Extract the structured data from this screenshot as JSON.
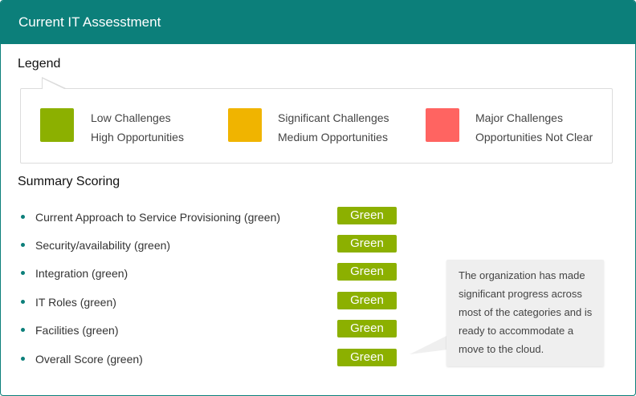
{
  "header": {
    "title": "Current IT Assesstment"
  },
  "legend": {
    "title": "Legend",
    "items": [
      {
        "line1": "Low Challenges",
        "line2": "High Opportunities",
        "color": "#8cb000",
        "icon": "swatch-green"
      },
      {
        "line1": "Significant Challenges",
        "line2": "Medium Opportunities",
        "color": "#f0b400",
        "icon": "swatch-yellow"
      },
      {
        "line1": "Major Challenges",
        "line2": "Opportunities Not Clear",
        "color": "#ff6461",
        "icon": "swatch-red"
      }
    ]
  },
  "summary": {
    "title": "Summary Scoring",
    "items": [
      {
        "label": "Current Approach to Service Provisioning (green)",
        "score": "Green"
      },
      {
        "label": "Security/availability (green)",
        "score": "Green"
      },
      {
        "label": "Integration (green)",
        "score": "Green"
      },
      {
        "label": "IT Roles (green)",
        "score": "Green"
      },
      {
        "label": "Facilities (green)",
        "score": "Green"
      },
      {
        "label": "Overall Score (green)",
        "score": "Green"
      }
    ]
  },
  "callout": {
    "text": "The organization has made significant progress across most of the categories and is ready to accommodate a move to the cloud."
  },
  "colors": {
    "header": "#0c7f7a",
    "badge": "#8cb000",
    "bullet": "#0c7f7a"
  }
}
